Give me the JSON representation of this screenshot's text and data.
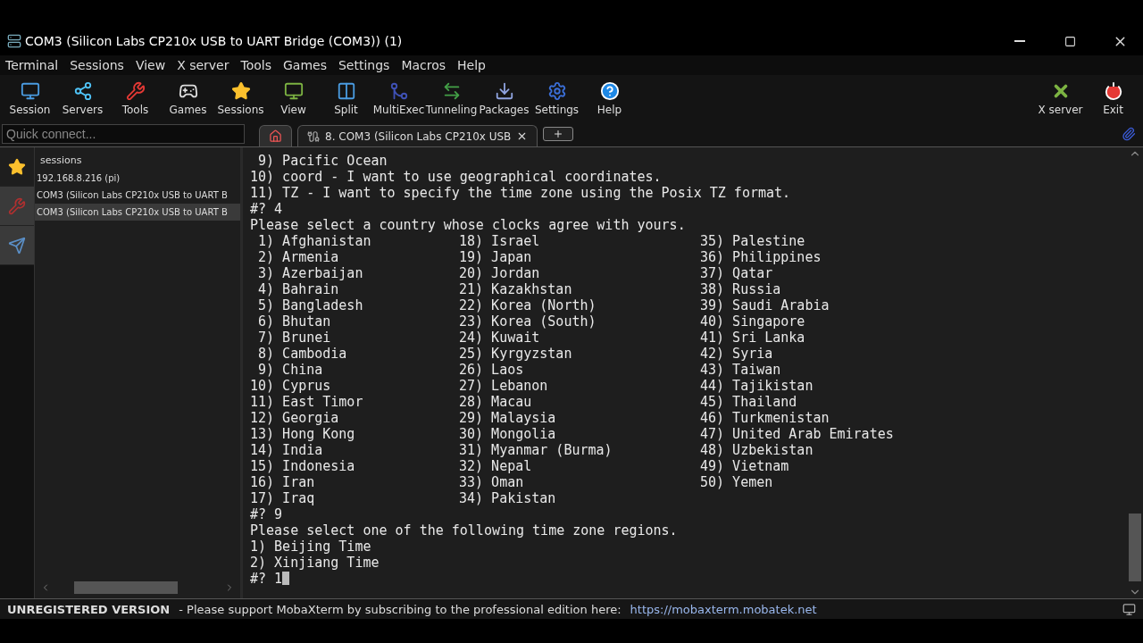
{
  "window": {
    "title": "COM3  (Silicon Labs CP210x USB to UART Bridge (COM3)) (1)"
  },
  "menu": [
    "Terminal",
    "Sessions",
    "View",
    "X server",
    "Tools",
    "Games",
    "Settings",
    "Macros",
    "Help"
  ],
  "toolbar": [
    {
      "label": "Session",
      "kind": "session"
    },
    {
      "label": "Servers",
      "kind": "servers"
    },
    {
      "label": "Tools",
      "kind": "tools"
    },
    {
      "label": "Games",
      "kind": "games"
    },
    {
      "label": "Sessions",
      "kind": "star"
    },
    {
      "label": "View",
      "kind": "view"
    },
    {
      "label": "Split",
      "kind": "split"
    },
    {
      "label": "MultiExec",
      "kind": "multiexec"
    },
    {
      "label": "Tunneling",
      "kind": "tunnel"
    },
    {
      "label": "Packages",
      "kind": "packages"
    },
    {
      "label": "Settings",
      "kind": "settings"
    },
    {
      "label": "Help",
      "kind": "help"
    }
  ],
  "toolbar_right": [
    {
      "label": "X server",
      "kind": "xserver"
    },
    {
      "label": "Exit",
      "kind": "exit"
    }
  ],
  "quick_connect": {
    "placeholder": "Quick connect..."
  },
  "tabs": [
    {
      "kind": "home",
      "selected": false
    },
    {
      "kind": "session",
      "label": "8. COM3  (Silicon Labs  CP210x USB",
      "selected": true
    }
  ],
  "sidebar": {
    "tabs": [
      {
        "kind": "star",
        "selected": true
      },
      {
        "kind": "tools",
        "selected": false
      },
      {
        "kind": "send",
        "selected": false
      }
    ],
    "header": "sessions",
    "items": [
      {
        "label": "192.168.8.216 (pi)",
        "selected": false
      },
      {
        "label": "COM3  (Silicon Labs CP210x USB to UART B",
        "selected": false
      },
      {
        "label": "COM3  (Silicon Labs CP210x USB to UART B",
        "selected": true
      }
    ]
  },
  "terminal": {
    "lines_before": [
      " 9) Pacific Ocean",
      "10) coord - I want to use geographical coordinates.",
      "11) TZ - I want to specify the time zone using the Posix TZ format.",
      "#? 4",
      "Please select a country whose clocks agree with yours."
    ],
    "country_rows": [
      [
        " 1) Afghanistan",
        "18) Israel",
        "35) Palestine"
      ],
      [
        " 2) Armenia",
        "19) Japan",
        "36) Philippines"
      ],
      [
        " 3) Azerbaijan",
        "20) Jordan",
        "37) Qatar"
      ],
      [
        " 4) Bahrain",
        "21) Kazakhstan",
        "38) Russia"
      ],
      [
        " 5) Bangladesh",
        "22) Korea (North)",
        "39) Saudi Arabia"
      ],
      [
        " 6) Bhutan",
        "23) Korea (South)",
        "40) Singapore"
      ],
      [
        " 7) Brunei",
        "24) Kuwait",
        "41) Sri Lanka"
      ],
      [
        " 8) Cambodia",
        "25) Kyrgyzstan",
        "42) Syria"
      ],
      [
        " 9) China",
        "26) Laos",
        "43) Taiwan"
      ],
      [
        "10) Cyprus",
        "27) Lebanon",
        "44) Tajikistan"
      ],
      [
        "11) East Timor",
        "28) Macau",
        "45) Thailand"
      ],
      [
        "12) Georgia",
        "29) Malaysia",
        "46) Turkmenistan"
      ],
      [
        "13) Hong Kong",
        "30) Mongolia",
        "47) United Arab Emirates"
      ],
      [
        "14) India",
        "31) Myanmar (Burma)",
        "48) Uzbekistan"
      ],
      [
        "15) Indonesia",
        "32) Nepal",
        "49) Vietnam"
      ],
      [
        "16) Iran",
        "33) Oman",
        "50) Yemen"
      ],
      [
        "17) Iraq",
        "34) Pakistan"
      ]
    ],
    "lines_after": [
      "#? 9",
      "Please select one of the following time zone regions.",
      "1) Beijing Time",
      "2) Xinjiang Time"
    ],
    "prompt": "#? 1"
  },
  "status_bar": {
    "label": "UNREGISTERED VERSION",
    "message": "-  Please support MobaXterm by subscribing to the professional edition here:",
    "link": "https://mobaxterm.mobatek.net"
  }
}
